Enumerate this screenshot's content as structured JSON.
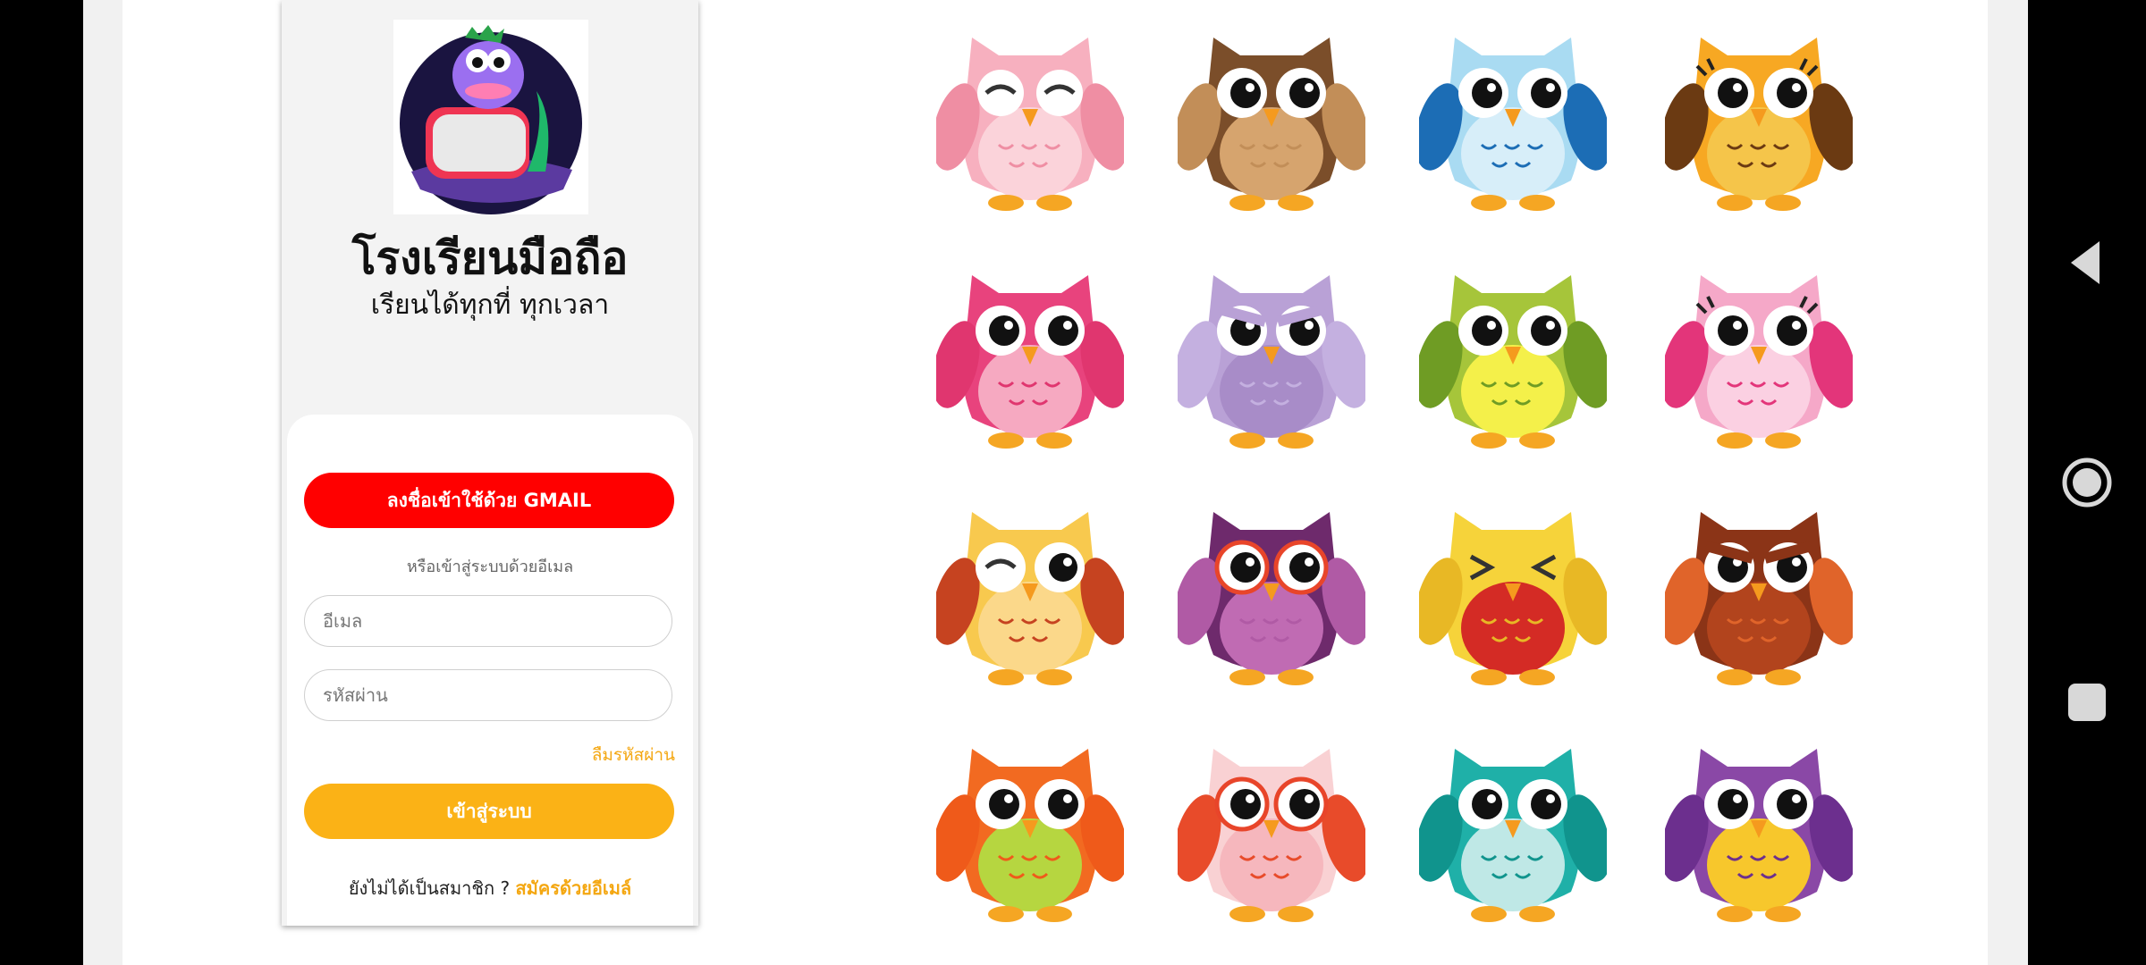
{
  "app": {
    "title": "โรงเรียนมือถือ",
    "subtitle": "เรียนได้ทุกที่ ทุกเวลา",
    "logo_icon": "owl-on-book-logo"
  },
  "login": {
    "gmail_button": "ลงชื่อเข้าใช้ด้วย GMAIL",
    "or_text": "หรือเข้าสู่ระบบด้วยอีเมล",
    "email_placeholder": "อีเมล",
    "password_placeholder": "รหัสผ่าน",
    "forgot_password": "ลืมรหัสผ่าน",
    "login_button": "เข้าสู่ระบบ",
    "not_member": "ยังไม่ได้เป็นสมาชิก ?",
    "signup_link": "สมัครด้วยอีเมล์"
  },
  "owls": [
    {
      "body": "#f7b0bf",
      "belly": "#fbd3da",
      "wing": "#ef8ea3",
      "eye": "closed"
    },
    {
      "body": "#7b4e2a",
      "belly": "#d6a46e",
      "wing": "#c28e58",
      "eye": "open"
    },
    {
      "body": "#a9dbf2",
      "belly": "#d7eef9",
      "wing": "#1c6db5",
      "eye": "open"
    },
    {
      "body": "#f7a823",
      "belly": "#f5c54a",
      "wing": "#6b3a12",
      "eye": "lash"
    },
    {
      "body": "#e8437d",
      "belly": "#f6a9c1",
      "wing": "#e0366f",
      "eye": "open"
    },
    {
      "body": "#b9a1d6",
      "belly": "#a88cc8",
      "wing": "#c4b0e0",
      "eye": "angry"
    },
    {
      "body": "#a6c53a",
      "belly": "#f4f04a",
      "wing": "#6f9c24",
      "eye": "open"
    },
    {
      "body": "#f5a8c8",
      "belly": "#fbd0e2",
      "wing": "#e3357a",
      "eye": "lash"
    },
    {
      "body": "#f8c94e",
      "belly": "#fbd88a",
      "wing": "#c64320",
      "eye": "wink"
    },
    {
      "body": "#6e2a6c",
      "belly": "#c06bb3",
      "wing": "#b05aa5",
      "eye": "glasses"
    },
    {
      "body": "#f6d33a",
      "belly": "#d42b25",
      "wing": "#e8b825",
      "eye": "squint"
    },
    {
      "body": "#8b3417",
      "belly": "#b2441d",
      "wing": "#e0642a",
      "eye": "angry"
    },
    {
      "body": "#f26a21",
      "belly": "#b6d640",
      "wing": "#ef5a1a",
      "eye": "open"
    },
    {
      "body": "#f9d1d3",
      "belly": "#f6b7bd",
      "wing": "#e84b2a",
      "eye": "glasses"
    },
    {
      "body": "#1fb0a8",
      "belly": "#bfe8e6",
      "wing": "#10948d",
      "eye": "open"
    },
    {
      "body": "#8a48a6",
      "belly": "#f7c72c",
      "wing": "#6c2f8e",
      "eye": "open"
    }
  ],
  "nav": {
    "back_icon": "back-triangle-icon",
    "home_icon": "home-circle-icon",
    "recents_icon": "recents-square-icon"
  }
}
